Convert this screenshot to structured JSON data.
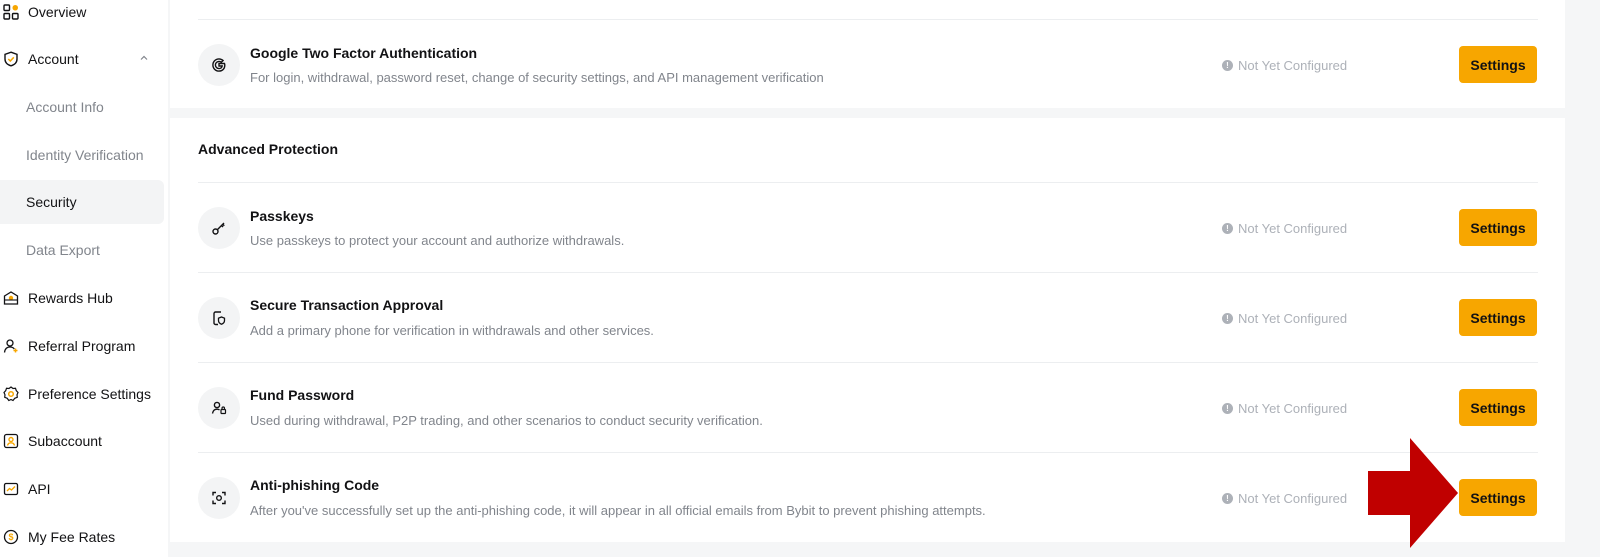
{
  "sidebar": {
    "items": [
      {
        "label": "Overview",
        "icon": "overview-icon"
      },
      {
        "label": "Account",
        "icon": "account-shield-icon"
      },
      {
        "label": "Account Info"
      },
      {
        "label": "Identity Verification"
      },
      {
        "label": "Security"
      },
      {
        "label": "Data Export"
      },
      {
        "label": "Rewards Hub",
        "icon": "gift-icon"
      },
      {
        "label": "Referral Program",
        "icon": "referral-user-icon"
      },
      {
        "label": "Preference Settings",
        "icon": "settings-gear-icon"
      },
      {
        "label": "Subaccount",
        "icon": "subaccount-icon"
      },
      {
        "label": "API",
        "icon": "api-icon"
      },
      {
        "label": "My Fee Rates",
        "icon": "fee-coin-icon"
      }
    ]
  },
  "security": {
    "google_2fa": {
      "title": "Google Two Factor Authentication",
      "description": "For login, withdrawal, password reset, change of security settings, and API management verification",
      "status": "Not Yet Configured",
      "button": "Settings",
      "icon": "google-icon"
    },
    "advanced": {
      "heading": "Advanced Protection",
      "rows": [
        {
          "title": "Passkeys",
          "description": "Use passkeys to protect your account and authorize withdrawals.",
          "status": "Not Yet Configured",
          "button": "Settings",
          "icon": "key-icon"
        },
        {
          "title": "Secure Transaction Approval",
          "description": "Add a primary phone for verification in withdrawals and other services.",
          "status": "Not Yet Configured",
          "button": "Settings",
          "icon": "phone-shield-icon"
        },
        {
          "title": "Fund Password",
          "description": "Used during withdrawal, P2P trading, and other scenarios to conduct security verification.",
          "status": "Not Yet Configured",
          "button": "Settings",
          "icon": "user-lock-icon"
        },
        {
          "title": "Anti-phishing Code",
          "description": "After you've successfully set up the anti-phishing code, it will appear in all official emails from Bybit to prevent phishing attempts.",
          "status": "Not Yet Configured",
          "button": "Settings",
          "icon": "scan-icon"
        }
      ]
    }
  },
  "colors": {
    "accent": "#f7a600",
    "arrow": "#c00000",
    "muted_text": "#81858c",
    "status_text": "#adb1b8"
  }
}
